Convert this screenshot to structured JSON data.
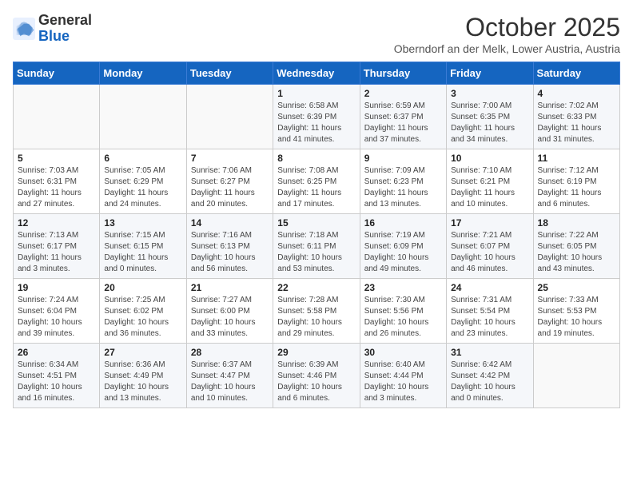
{
  "header": {
    "logo_general": "General",
    "logo_blue": "Blue",
    "month_title": "October 2025",
    "location": "Oberndorf an der Melk, Lower Austria, Austria"
  },
  "weekdays": [
    "Sunday",
    "Monday",
    "Tuesday",
    "Wednesday",
    "Thursday",
    "Friday",
    "Saturday"
  ],
  "weeks": [
    [
      {
        "day": "",
        "info": ""
      },
      {
        "day": "",
        "info": ""
      },
      {
        "day": "",
        "info": ""
      },
      {
        "day": "1",
        "info": "Sunrise: 6:58 AM\nSunset: 6:39 PM\nDaylight: 11 hours\nand 41 minutes."
      },
      {
        "day": "2",
        "info": "Sunrise: 6:59 AM\nSunset: 6:37 PM\nDaylight: 11 hours\nand 37 minutes."
      },
      {
        "day": "3",
        "info": "Sunrise: 7:00 AM\nSunset: 6:35 PM\nDaylight: 11 hours\nand 34 minutes."
      },
      {
        "day": "4",
        "info": "Sunrise: 7:02 AM\nSunset: 6:33 PM\nDaylight: 11 hours\nand 31 minutes."
      }
    ],
    [
      {
        "day": "5",
        "info": "Sunrise: 7:03 AM\nSunset: 6:31 PM\nDaylight: 11 hours\nand 27 minutes."
      },
      {
        "day": "6",
        "info": "Sunrise: 7:05 AM\nSunset: 6:29 PM\nDaylight: 11 hours\nand 24 minutes."
      },
      {
        "day": "7",
        "info": "Sunrise: 7:06 AM\nSunset: 6:27 PM\nDaylight: 11 hours\nand 20 minutes."
      },
      {
        "day": "8",
        "info": "Sunrise: 7:08 AM\nSunset: 6:25 PM\nDaylight: 11 hours\nand 17 minutes."
      },
      {
        "day": "9",
        "info": "Sunrise: 7:09 AM\nSunset: 6:23 PM\nDaylight: 11 hours\nand 13 minutes."
      },
      {
        "day": "10",
        "info": "Sunrise: 7:10 AM\nSunset: 6:21 PM\nDaylight: 11 hours\nand 10 minutes."
      },
      {
        "day": "11",
        "info": "Sunrise: 7:12 AM\nSunset: 6:19 PM\nDaylight: 11 hours\nand 6 minutes."
      }
    ],
    [
      {
        "day": "12",
        "info": "Sunrise: 7:13 AM\nSunset: 6:17 PM\nDaylight: 11 hours\nand 3 minutes."
      },
      {
        "day": "13",
        "info": "Sunrise: 7:15 AM\nSunset: 6:15 PM\nDaylight: 11 hours\nand 0 minutes."
      },
      {
        "day": "14",
        "info": "Sunrise: 7:16 AM\nSunset: 6:13 PM\nDaylight: 10 hours\nand 56 minutes."
      },
      {
        "day": "15",
        "info": "Sunrise: 7:18 AM\nSunset: 6:11 PM\nDaylight: 10 hours\nand 53 minutes."
      },
      {
        "day": "16",
        "info": "Sunrise: 7:19 AM\nSunset: 6:09 PM\nDaylight: 10 hours\nand 49 minutes."
      },
      {
        "day": "17",
        "info": "Sunrise: 7:21 AM\nSunset: 6:07 PM\nDaylight: 10 hours\nand 46 minutes."
      },
      {
        "day": "18",
        "info": "Sunrise: 7:22 AM\nSunset: 6:05 PM\nDaylight: 10 hours\nand 43 minutes."
      }
    ],
    [
      {
        "day": "19",
        "info": "Sunrise: 7:24 AM\nSunset: 6:04 PM\nDaylight: 10 hours\nand 39 minutes."
      },
      {
        "day": "20",
        "info": "Sunrise: 7:25 AM\nSunset: 6:02 PM\nDaylight: 10 hours\nand 36 minutes."
      },
      {
        "day": "21",
        "info": "Sunrise: 7:27 AM\nSunset: 6:00 PM\nDaylight: 10 hours\nand 33 minutes."
      },
      {
        "day": "22",
        "info": "Sunrise: 7:28 AM\nSunset: 5:58 PM\nDaylight: 10 hours\nand 29 minutes."
      },
      {
        "day": "23",
        "info": "Sunrise: 7:30 AM\nSunset: 5:56 PM\nDaylight: 10 hours\nand 26 minutes."
      },
      {
        "day": "24",
        "info": "Sunrise: 7:31 AM\nSunset: 5:54 PM\nDaylight: 10 hours\nand 23 minutes."
      },
      {
        "day": "25",
        "info": "Sunrise: 7:33 AM\nSunset: 5:53 PM\nDaylight: 10 hours\nand 19 minutes."
      }
    ],
    [
      {
        "day": "26",
        "info": "Sunrise: 6:34 AM\nSunset: 4:51 PM\nDaylight: 10 hours\nand 16 minutes."
      },
      {
        "day": "27",
        "info": "Sunrise: 6:36 AM\nSunset: 4:49 PM\nDaylight: 10 hours\nand 13 minutes."
      },
      {
        "day": "28",
        "info": "Sunrise: 6:37 AM\nSunset: 4:47 PM\nDaylight: 10 hours\nand 10 minutes."
      },
      {
        "day": "29",
        "info": "Sunrise: 6:39 AM\nSunset: 4:46 PM\nDaylight: 10 hours\nand 6 minutes."
      },
      {
        "day": "30",
        "info": "Sunrise: 6:40 AM\nSunset: 4:44 PM\nDaylight: 10 hours\nand 3 minutes."
      },
      {
        "day": "31",
        "info": "Sunrise: 6:42 AM\nSunset: 4:42 PM\nDaylight: 10 hours\nand 0 minutes."
      },
      {
        "day": "",
        "info": ""
      }
    ]
  ]
}
